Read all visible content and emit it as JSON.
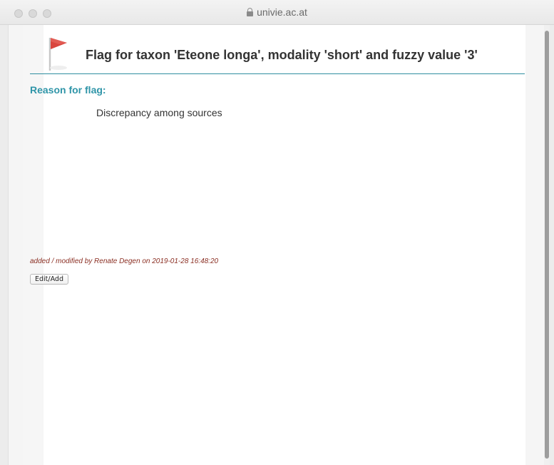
{
  "browser": {
    "url": "univie.ac.at"
  },
  "header": {
    "title": "Flag for taxon 'Eteone longa', modality 'short' and fuzzy value '3'"
  },
  "reason": {
    "label": "Reason for flag:",
    "value": "Discrepancy among sources"
  },
  "footer": {
    "modified_info": "added / modified by Renate Degen on 2019-01-28 16:48:20",
    "edit_button_label": "Edit/Add"
  },
  "colors": {
    "accent": "#2f95a8",
    "flag": "#d9463f",
    "modified_text": "#8a2e22"
  },
  "icons": {
    "flag": "red-flag-icon",
    "lock": "lock-icon"
  }
}
